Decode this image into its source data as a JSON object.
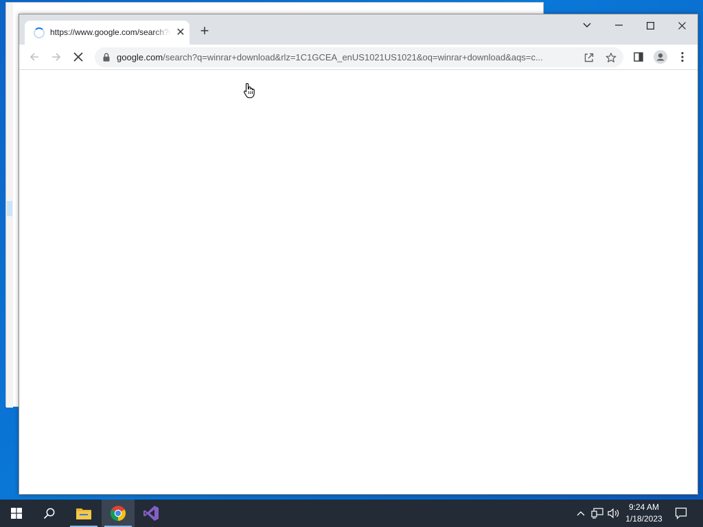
{
  "browser": {
    "tab": {
      "title": "https://www.google.com/search?q=winrar+download",
      "close_glyph": "✕",
      "favicon": "loading-spinner"
    },
    "new_tab_glyph": "+",
    "window_controls": {
      "tab_search_glyph": "⌄",
      "minimize_glyph": "—",
      "maximize_glyph": "☐",
      "close_glyph": "✕"
    },
    "toolbar": {
      "back_icon": "arrow-left-icon",
      "forward_icon": "arrow-right-icon",
      "stop_icon": "stop-x-icon",
      "url_host": "google.com",
      "url_rest": "/search?q=winrar+download&rlz=1C1GCEA_enUS1021US1021&oq=winrar+download&aqs=c..."
    }
  },
  "taskbar": {
    "apps": [
      "start-icon",
      "search-icon",
      "file-explorer-icon",
      "chrome-icon",
      "visual-studio-icon"
    ],
    "clock": {
      "time": "9:24 AM",
      "date": "1/18/2023"
    }
  },
  "colors": {
    "desktop": "#0a6fd0",
    "taskbar": "#222b36",
    "tabstrip": "#dee1e6",
    "omnibox": "#f1f3f4"
  }
}
